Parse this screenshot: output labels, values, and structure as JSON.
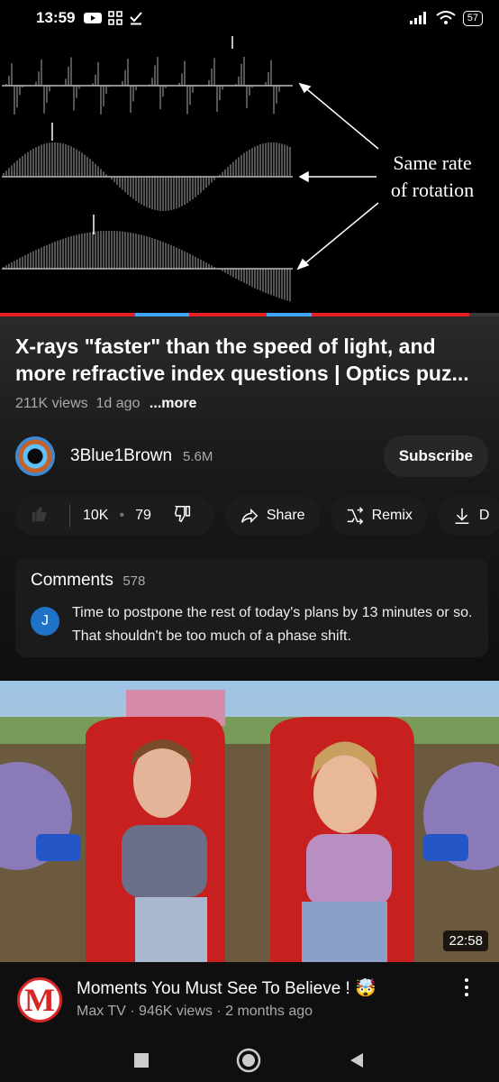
{
  "status_bar": {
    "time": "13:59",
    "battery": "57"
  },
  "player": {
    "annotation_line1": "Same rate",
    "annotation_line2": "of rotation",
    "progress_fraction": 0.94
  },
  "video": {
    "title_line1": "X-rays \"faster\" than the speed of light, and",
    "title_line2": "more refractive index questions | Optics puz...",
    "views": "211K views",
    "age": "1d ago",
    "more_label": "...more"
  },
  "channel": {
    "name": "3Blue1Brown",
    "subscribers": "5.6M",
    "subscribe_label": "Subscribe"
  },
  "actions": {
    "likes": "10K",
    "comments_count": "79",
    "share_label": "Share",
    "remix_label": "Remix",
    "download_label": "D"
  },
  "comments": {
    "heading": "Comments",
    "count": "578",
    "top_author_initial": "J",
    "top_comment": "Time to postpone the rest of today's plans by 13 minutes or so. That shouldn't be too much of a phase shift."
  },
  "next_video": {
    "duration": "22:58",
    "title": "Moments You Must See To Believe ! 🤯",
    "channel": "Max TV",
    "views": "946K views",
    "age": "2 months ago",
    "logo_letter": "M"
  }
}
